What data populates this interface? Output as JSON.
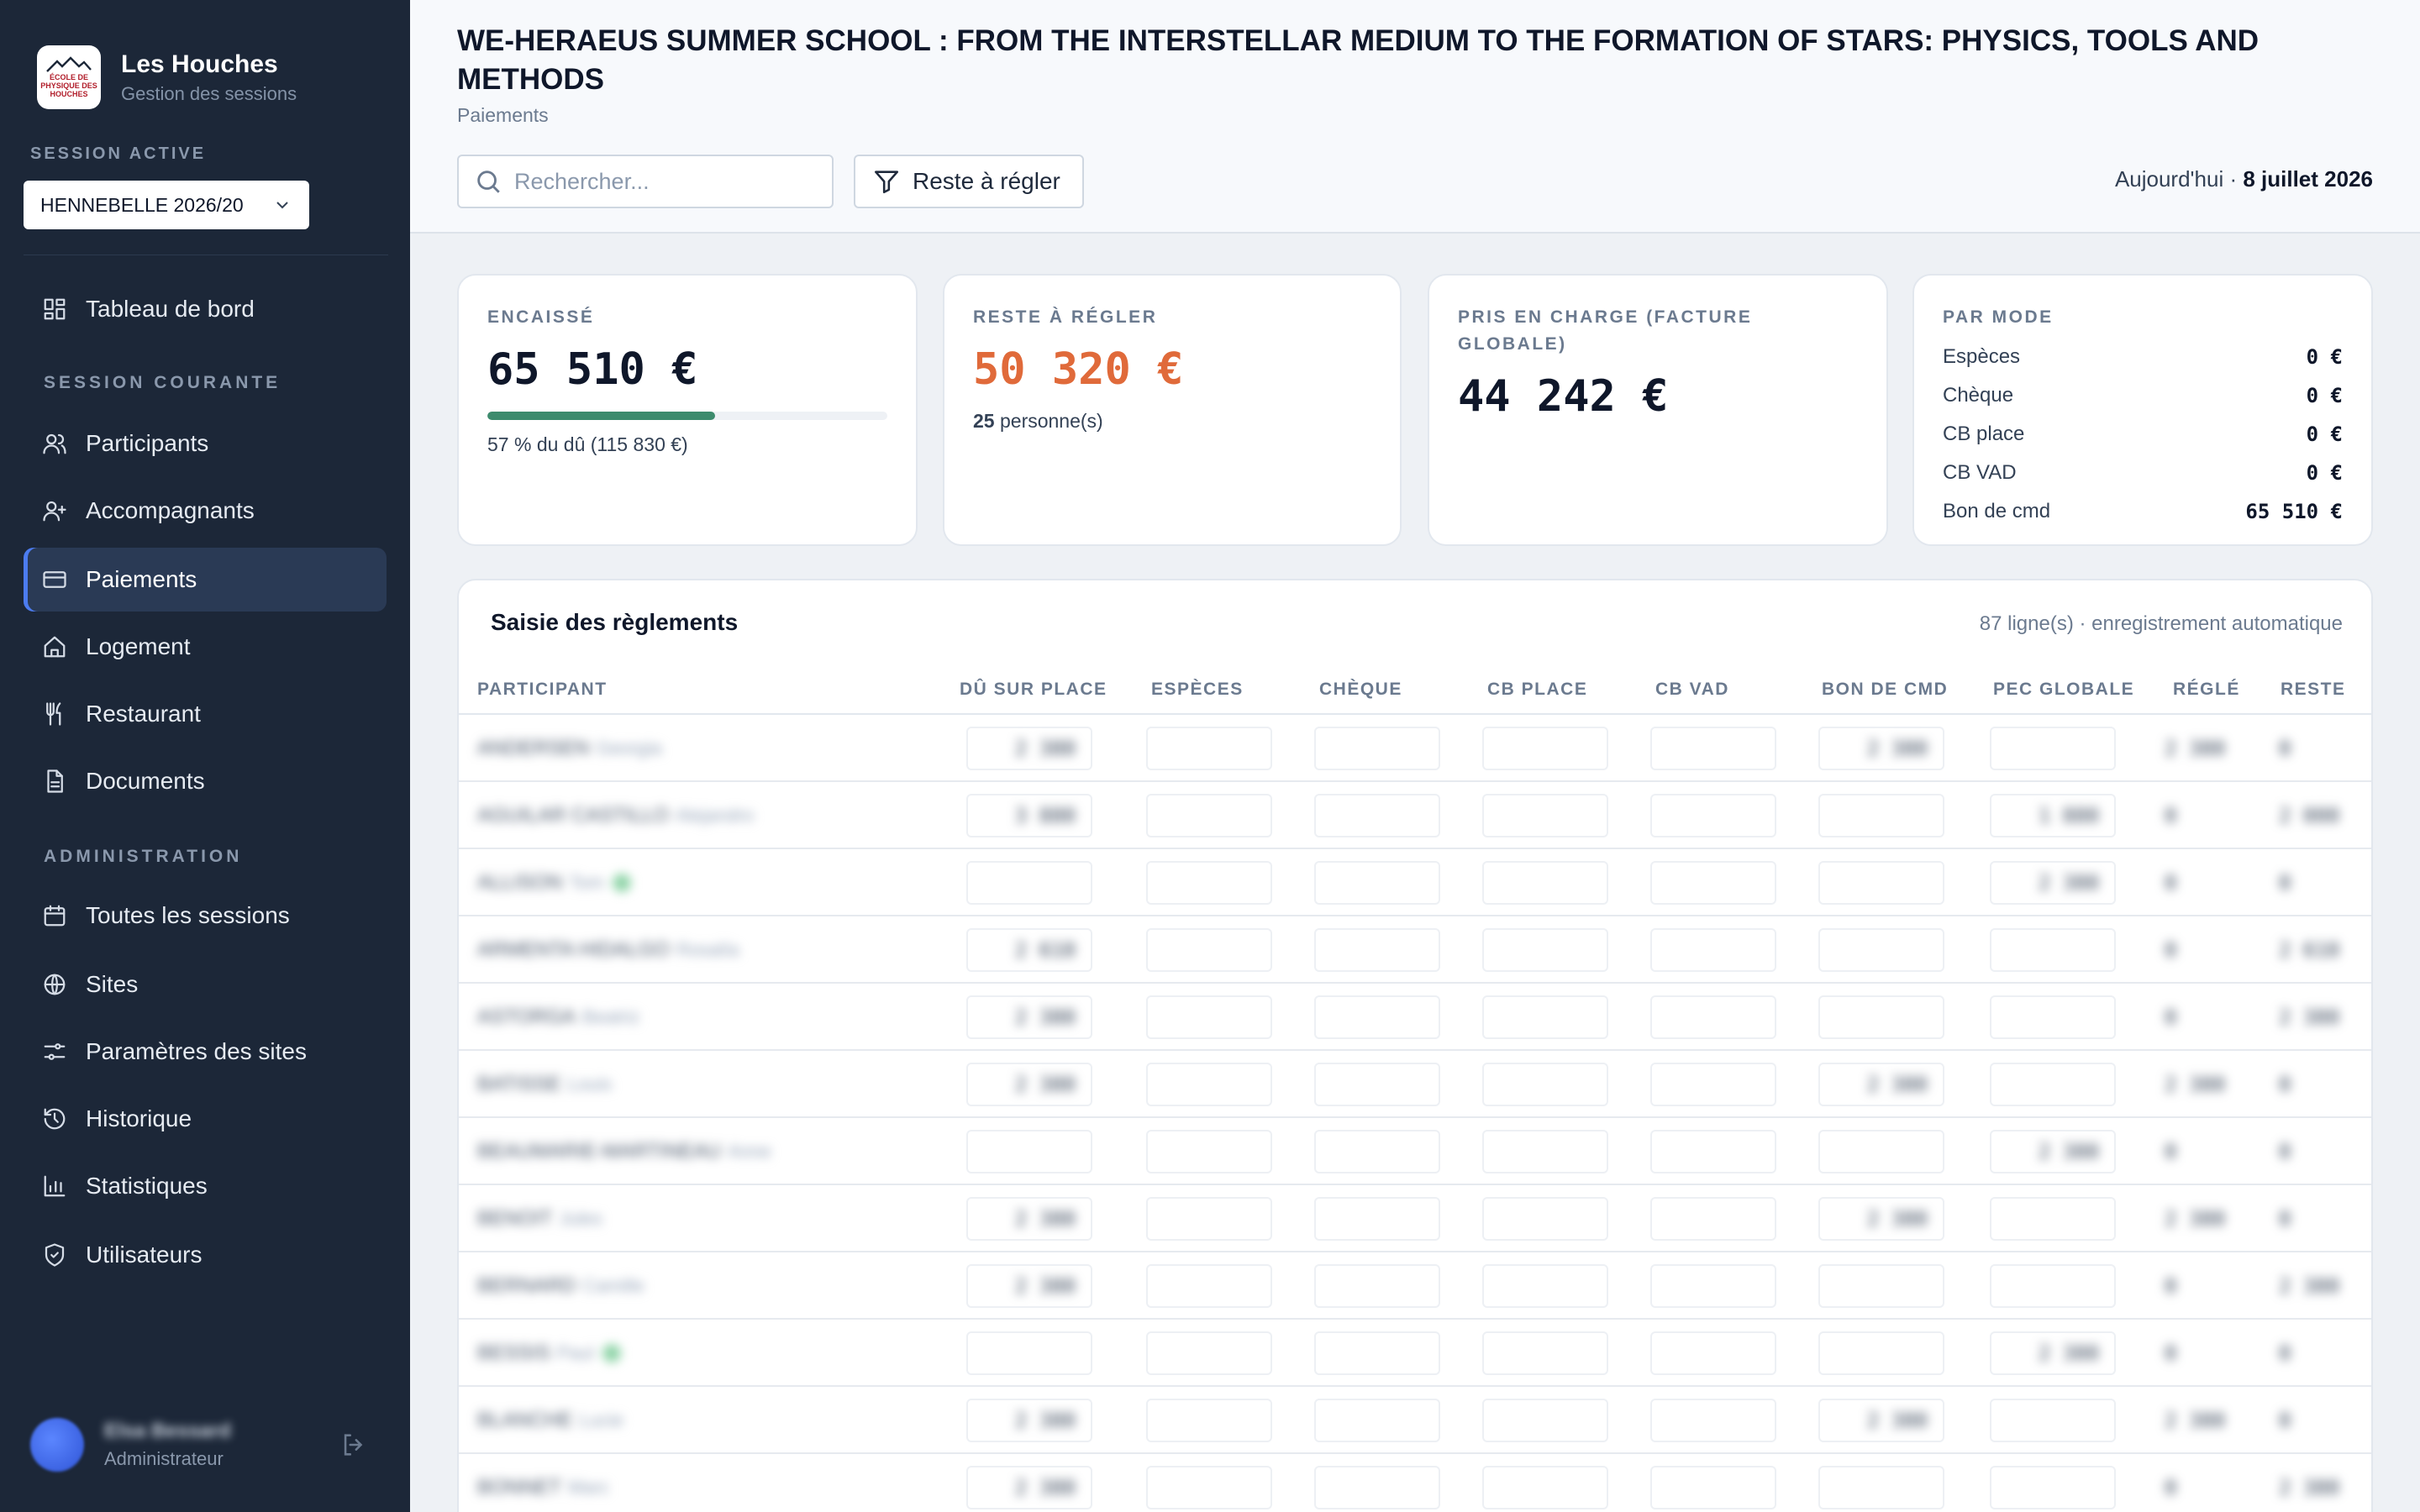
{
  "app": {
    "title": "Les Houches",
    "subtitle": "Gestion des sessions",
    "logo_text": "ÉCOLE DE PHYSIQUE DES HOUCHES"
  },
  "session": {
    "label": "SESSION ACTIVE",
    "value": "HENNEBELLE 2026/20"
  },
  "nav": {
    "dashboard": "Tableau de bord",
    "section_current": "SESSION COURANTE",
    "participants": "Participants",
    "accompagnants": "Accompagnants",
    "paiements": "Paiements",
    "logement": "Logement",
    "restaurant": "Restaurant",
    "documents": "Documents",
    "section_admin": "ADMINISTRATION",
    "sessions": "Toutes les sessions",
    "sites": "Sites",
    "params": "Paramètres des sites",
    "historique": "Historique",
    "stats": "Statistiques",
    "users": "Utilisateurs"
  },
  "user": {
    "name": "Elsa Bessard",
    "role": "Administrateur"
  },
  "header": {
    "title": "WE-HERAEUS SUMMER SCHOOL : FROM THE INTERSTELLAR MEDIUM TO THE FORMATION OF STARS: PHYSICS, TOOLS AND METHODS",
    "breadcrumb": "Paiements",
    "search_placeholder": "Rechercher...",
    "filter_label": "Reste à régler",
    "today_prefix": "Aujourd'hui ·",
    "today_date": "8 juillet 2026"
  },
  "cards": {
    "encaisse": {
      "label": "ENCAISSÉ",
      "value": "65 510 €",
      "percent": 57,
      "sub_pct": "57",
      "sub_text": " % du dû (115 830 €)"
    },
    "reste": {
      "label": "RESTE À RÉGLER",
      "value": "50 320 €",
      "count": "25",
      "count_text": " personne(s)"
    },
    "pec": {
      "label": "PRIS EN CHARGE (FACTURE GLOBALE)",
      "value": "44 242 €"
    },
    "modes": {
      "label": "PAR MODE",
      "items": [
        {
          "name": "Espèces",
          "value": "0 €"
        },
        {
          "name": "Chèque",
          "value": "0 €"
        },
        {
          "name": "CB place",
          "value": "0 €"
        },
        {
          "name": "CB VAD",
          "value": "0 €"
        },
        {
          "name": "Bon de cmd",
          "value": "65 510 €"
        }
      ]
    }
  },
  "table": {
    "title": "Saisie des règlements",
    "meta": "87 ligne(s) · enregistrement automatique",
    "headers": [
      "PARTICIPANT",
      "DÛ SUR PLACE",
      "ESPÈCES",
      "CHÈQUE",
      "CB PLACE",
      "CB VAD",
      "BON DE CMD",
      "PEC GLOBALE",
      "RÉGLÉ",
      "RESTE"
    ],
    "rows": [
      {
        "name": "ANDERSEN",
        "first": "Georgia",
        "due": "2 380",
        "bon": "2 380",
        "pec": "",
        "regle": "2 380",
        "reste": "0",
        "badge": false
      },
      {
        "name": "AGUILAR CASTILLO",
        "first": "Alejandro",
        "due": "3 880",
        "bon": "",
        "pec": "1 880",
        "regle": "0",
        "reste": "2 000",
        "badge": false
      },
      {
        "name": "ALLISON",
        "first": "Tom",
        "due": "",
        "bon": "",
        "pec": "2 380",
        "regle": "0",
        "reste": "0",
        "badge": true
      },
      {
        "name": "ARMENTA HIDALGO",
        "first": "Rosalía",
        "due": "2 610",
        "bon": "",
        "pec": "",
        "regle": "0",
        "reste": "2 610",
        "badge": false
      },
      {
        "name": "ASTORGA",
        "first": "Beatriz",
        "due": "2 380",
        "bon": "",
        "pec": "",
        "regle": "0",
        "reste": "2 380",
        "badge": false
      },
      {
        "name": "BATISSE",
        "first": "Louis",
        "due": "2 380",
        "bon": "2 380",
        "pec": "",
        "regle": "2 380",
        "reste": "0",
        "badge": false
      },
      {
        "name": "BEAUMARIE-MARTINEAU",
        "first": "Anne",
        "due": "",
        "bon": "",
        "pec": "2 380",
        "regle": "0",
        "reste": "0",
        "badge": false
      },
      {
        "name": "BENOIT",
        "first": "Jules",
        "due": "2 380",
        "bon": "2 380",
        "pec": "",
        "regle": "2 380",
        "reste": "0",
        "badge": false
      },
      {
        "name": "BERNARD",
        "first": "Camille",
        "due": "2 380",
        "bon": "",
        "pec": "",
        "regle": "0",
        "reste": "2 380",
        "badge": false
      },
      {
        "name": "BESSIS",
        "first": "Paul",
        "due": "",
        "bon": "",
        "pec": "2 380",
        "regle": "0",
        "reste": "0",
        "badge": true
      },
      {
        "name": "BLANCHE",
        "first": "Lucie",
        "due": "2 380",
        "bon": "2 380",
        "pec": "",
        "regle": "2 380",
        "reste": "0",
        "badge": false
      },
      {
        "name": "BONNET",
        "first": "Marc",
        "due": "2 380",
        "bon": "",
        "pec": "",
        "regle": "0",
        "reste": "2 380",
        "badge": false
      }
    ]
  },
  "colors": {
    "sidebar": "#1c2738",
    "accent": "#4c7cf0",
    "reste": "#e06a3a",
    "progress": "#3d8b6d"
  }
}
